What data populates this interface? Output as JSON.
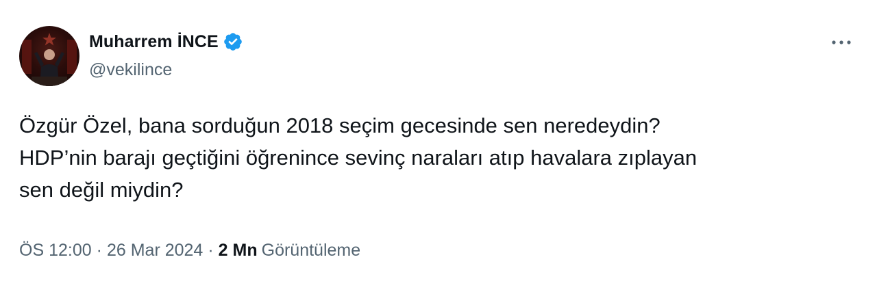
{
  "author": {
    "display_name": "Muharrem İNCE",
    "handle": "@vekilince",
    "verified": true,
    "verified_color": "#1d9bf0"
  },
  "tweet": {
    "lines": [
      "Özgür Özel, bana sorduğun 2018 seçim gecesinde sen neredeydin?",
      "HDP’nin barajı geçtiğini öğrenince sevinç naraları atıp havalara zıplayan",
      "sen değil miydin?"
    ]
  },
  "meta": {
    "time": "ÖS 12:00",
    "separator": "·",
    "date": "26 Mar 2024",
    "views_count": "2 Mn",
    "views_label": "Görüntüleme"
  },
  "icons": {
    "more": "more-horizontal-icon",
    "verified": "verified-badge-icon"
  },
  "colors": {
    "text_primary": "#0f1419",
    "text_secondary": "#536471",
    "accent": "#1d9bf0"
  }
}
